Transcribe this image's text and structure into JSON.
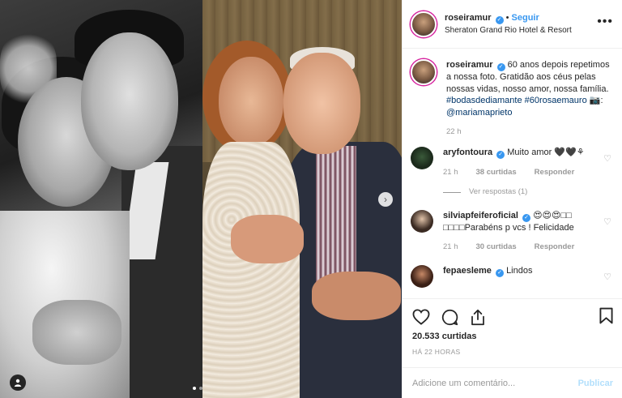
{
  "header": {
    "username": "roseiramur",
    "follow_label": "Seguir",
    "separator": "•",
    "location": "Sheraton Grand Rio Hotel & Resort",
    "more_label": "•••"
  },
  "caption": {
    "username": "roseiramur",
    "text": "60 anos depois repetimos a nossa foto. Gratidão aos céus pelas nossas vidas, nosso amor, nossa família.",
    "hashtag1": "#bodasdediamante",
    "hashtag2": "#60rosaemauro",
    "photo_credit_prefix": " 📷: ",
    "mention": "@mariamaprieto",
    "time": "22 h"
  },
  "comments": [
    {
      "username": "aryfontoura",
      "text": "Muito amor 🖤🖤⚘",
      "time": "21 h",
      "likes": "38 curtidas",
      "reply": "Responder",
      "view_replies": "Ver respostas (1)"
    },
    {
      "username": "silviapfeiferoficial",
      "text": "😍😍😍□□ □□□□Parabéns p vcs ! Felicidade",
      "time": "21 h",
      "likes": "30 curtidas",
      "reply": "Responder"
    },
    {
      "username": "fepaesleme",
      "text": "Lindos"
    }
  ],
  "actions": {
    "likes_count": "20.533 curtidas",
    "posted_time": "HÁ 22 HORAS"
  },
  "composer": {
    "placeholder": "Adicione um comentário...",
    "publish_label": "Publicar"
  },
  "media": {
    "next_arrow": "›",
    "user_tag_icon": "👤"
  },
  "colors": {
    "verified": "#3897f0",
    "link": "#003569",
    "follow": "#3897f0",
    "publish_disabled": "#b2dffc"
  },
  "icons": [
    "heart-icon",
    "comment-icon",
    "share-icon",
    "bookmark-icon",
    "verified-badge-icon",
    "more-options-icon",
    "next-arrow-icon",
    "user-tag-icon"
  ]
}
